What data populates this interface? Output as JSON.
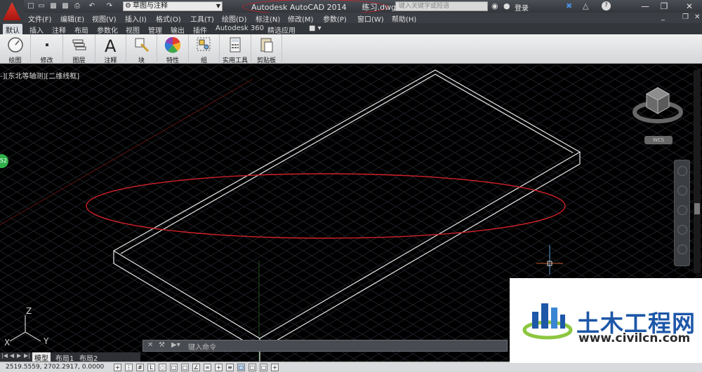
{
  "titlebar": {
    "workspace": "草图与注释",
    "app_name": "Autodesk AutoCAD 2014",
    "file_name": "练习.dwg",
    "search_placeholder": "键入关键字或短语",
    "login": "登录"
  },
  "menubar": {
    "items": [
      "文件(F)",
      "编辑(E)",
      "视图(V)",
      "插入(I)",
      "格式(O)",
      "工具(T)",
      "绘图(D)",
      "标注(N)",
      "修改(M)",
      "参数(P)",
      "窗口(W)",
      "帮助(H)"
    ]
  },
  "ribbon_tabs": {
    "items": [
      "默认",
      "插入",
      "注释",
      "布局",
      "参数化",
      "视图",
      "管理",
      "输出",
      "插件",
      "Autodesk 360",
      "精选应用"
    ]
  },
  "ribbon": {
    "panels": [
      "绘图",
      "修改",
      "图层",
      "注释",
      "块",
      "特性",
      "组",
      "实用工具",
      "剪贴板"
    ]
  },
  "viewport": {
    "label": "-][东北等轴测][二维线框]",
    "badge": "52",
    "wcs": "WCS"
  },
  "layout_tabs": {
    "items": [
      "模型",
      "布局1",
      "布局2"
    ]
  },
  "cmdline": {
    "placeholder": "键入命令"
  },
  "status": {
    "coords": "2519.5559, 2702.2917, 0.0000"
  },
  "watermark": {
    "title": "土木工程网",
    "url": "www.civilcn.com"
  },
  "colors": {
    "annotation_red": "#d0212a",
    "watermark_blue": "#1d57a8",
    "watermark_green": "#8cc63f"
  }
}
